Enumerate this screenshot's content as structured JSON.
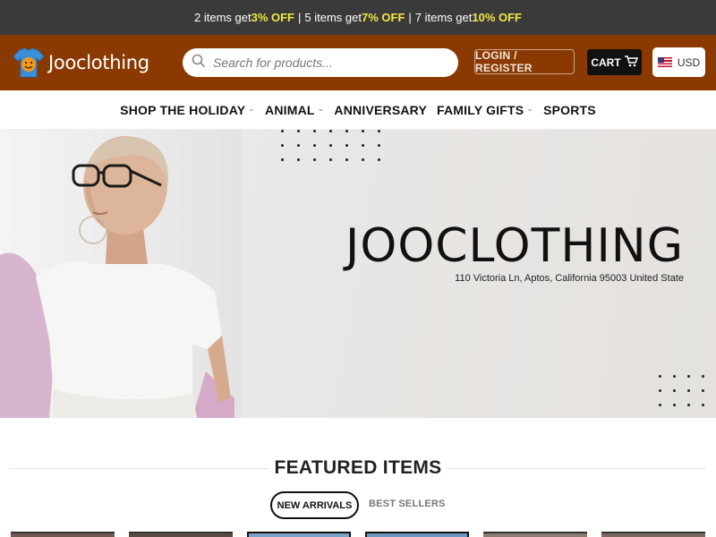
{
  "promo": {
    "part1_prefix": "2 items get ",
    "part1_deal": "3% OFF",
    "part2_prefix": "5 items get ",
    "part2_deal": "7% OFF",
    "part3_prefix": "7 items get ",
    "part3_deal": "10% OFF",
    "separator": "|"
  },
  "header": {
    "logo_text": "Jooclothing",
    "search_placeholder": "Search for products...",
    "login_label": "LOGIN / REGISTER",
    "cart_label": "CART",
    "currency": "USD",
    "colors": {
      "bar": "#8a3a00",
      "promo_bg": "#3a3a3a",
      "deal_highlight": "#f5e642"
    }
  },
  "nav": {
    "items": [
      {
        "label": "SHOP THE HOLIDAY",
        "has_dropdown": true
      },
      {
        "label": "ANIMAL",
        "has_dropdown": true
      },
      {
        "label": "ANNIVERSARY",
        "has_dropdown": false
      },
      {
        "label": "FAMILY GIFTS",
        "has_dropdown": true
      },
      {
        "label": "SPORTS",
        "has_dropdown": false
      }
    ]
  },
  "hero": {
    "title": "JOOCLOTHING",
    "address": "110 Victoria Ln, Aptos, California 95003 United State"
  },
  "featured": {
    "title": "FEATURED ITEMS",
    "tabs": [
      {
        "label": "NEW ARRIVALS",
        "active": true
      },
      {
        "label": "BEST SELLERS",
        "active": false
      }
    ]
  }
}
